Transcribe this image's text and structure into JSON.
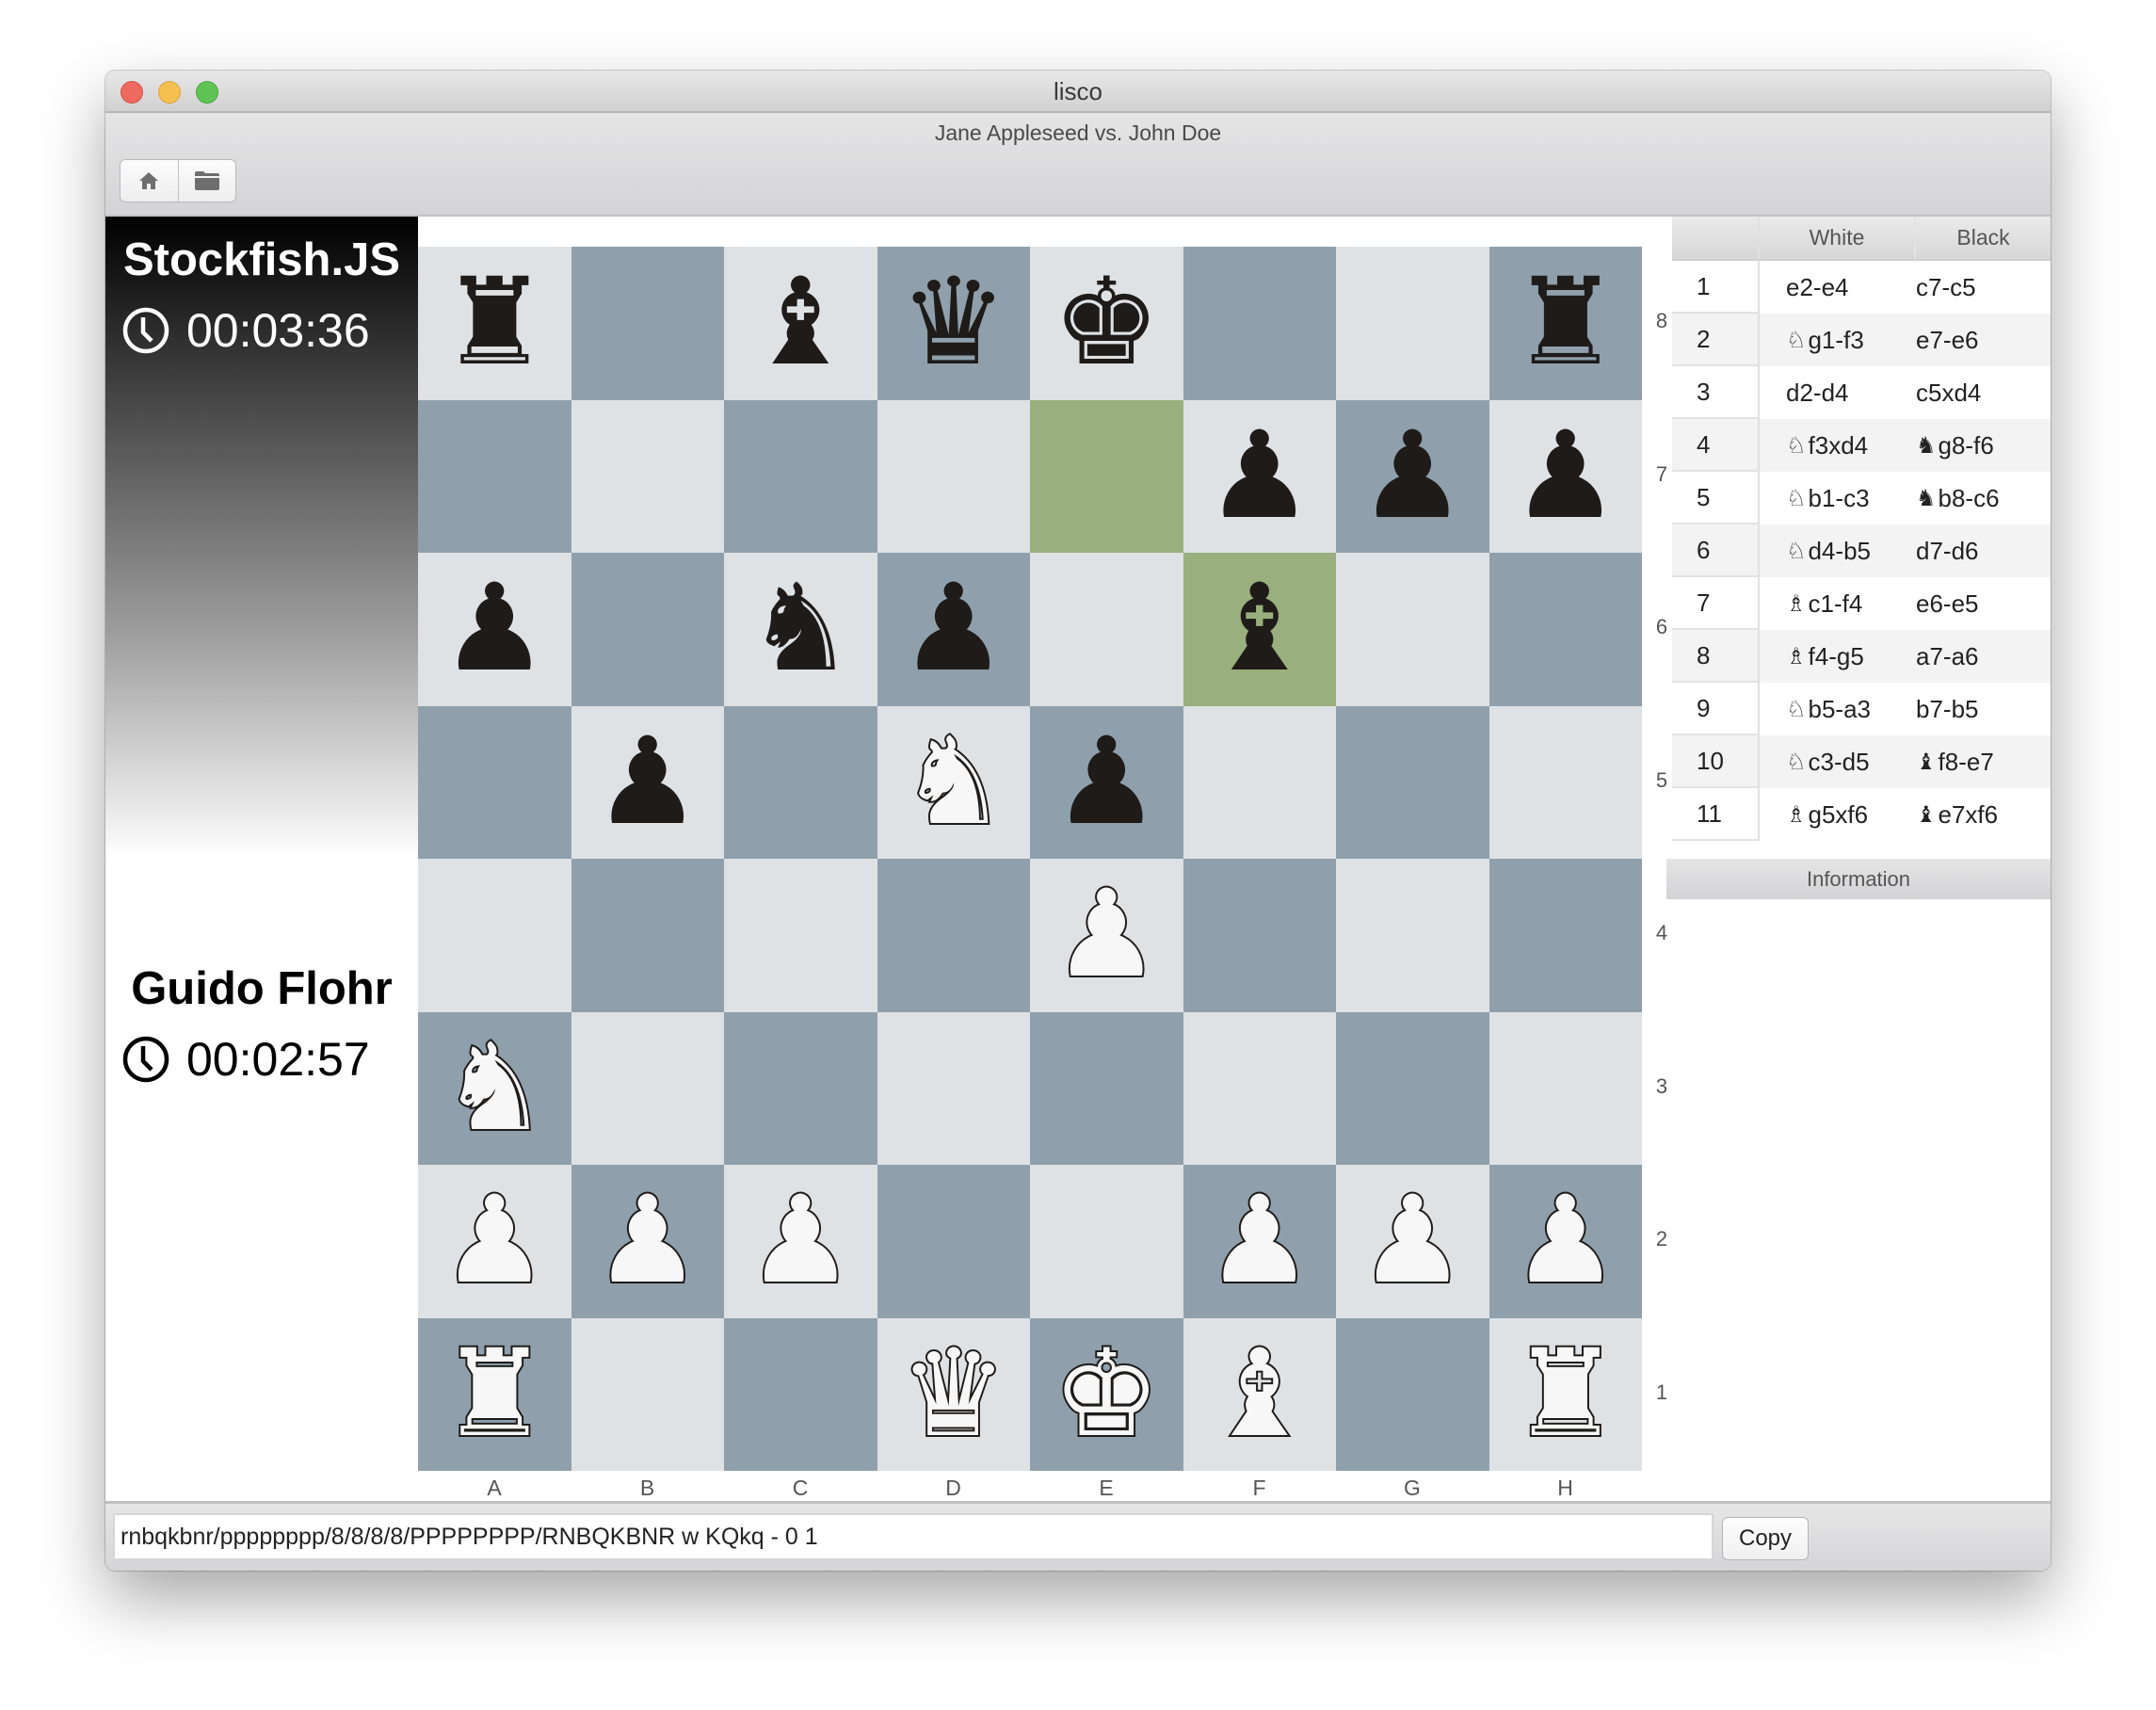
{
  "window": {
    "app_title": "lisco",
    "subtitle": "Jane Appleseed vs. John Doe"
  },
  "toolbar": {
    "buttons": [
      {
        "icon": "home-icon",
        "label": "Home"
      },
      {
        "icon": "folder-open-icon",
        "label": "Open"
      }
    ]
  },
  "players": {
    "top": {
      "name": "Stockfish.JS",
      "clock": "00:03:36",
      "color": "black"
    },
    "bottom": {
      "name": "Guido Flohr",
      "clock": "00:02:57",
      "color": "white"
    }
  },
  "board": {
    "colors": {
      "light": "#dfe2e5",
      "dark": "#8fa0ac",
      "highlight": "#99af7d"
    },
    "ranks": [
      [
        "r",
        "",
        "b",
        "q",
        "k",
        "",
        "",
        "r"
      ],
      [
        "",
        "",
        "",
        "",
        "",
        "p",
        "p",
        "p"
      ],
      [
        "p",
        "",
        "n",
        "p",
        "",
        "b",
        "",
        ""
      ],
      [
        "",
        "p",
        "",
        "N",
        "p",
        "",
        "",
        ""
      ],
      [
        "",
        "",
        "",
        "",
        "P",
        "",
        "",
        ""
      ],
      [
        "N",
        "",
        "",
        "",
        "",
        "",
        "",
        ""
      ],
      [
        "P",
        "P",
        "P",
        "",
        "",
        "P",
        "P",
        "P"
      ],
      [
        "R",
        "",
        "",
        "Q",
        "K",
        "B",
        "",
        "R"
      ]
    ],
    "highlighted_squares": [
      "e7",
      "f6"
    ],
    "rank_labels": [
      "8",
      "7",
      "6",
      "5",
      "4",
      "3",
      "2",
      "1"
    ],
    "file_labels": [
      "A",
      "B",
      "C",
      "D",
      "E",
      "F",
      "G",
      "H"
    ]
  },
  "moves": {
    "headers": {
      "number": "",
      "white": "White",
      "black": "Black"
    },
    "rows": [
      {
        "n": "1",
        "white": {
          "piece": "",
          "text": "e2-e4"
        },
        "black": {
          "piece": "",
          "text": "c7-c5"
        }
      },
      {
        "n": "2",
        "white": {
          "piece": "N",
          "text": "g1-f3"
        },
        "black": {
          "piece": "",
          "text": "e7-e6"
        }
      },
      {
        "n": "3",
        "white": {
          "piece": "",
          "text": "d2-d4"
        },
        "black": {
          "piece": "",
          "text": "c5xd4"
        }
      },
      {
        "n": "4",
        "white": {
          "piece": "N",
          "text": "f3xd4"
        },
        "black": {
          "piece": "n",
          "text": "g8-f6"
        }
      },
      {
        "n": "5",
        "white": {
          "piece": "N",
          "text": "b1-c3"
        },
        "black": {
          "piece": "n",
          "text": "b8-c6"
        }
      },
      {
        "n": "6",
        "white": {
          "piece": "N",
          "text": "d4-b5"
        },
        "black": {
          "piece": "",
          "text": "d7-d6"
        }
      },
      {
        "n": "7",
        "white": {
          "piece": "B",
          "text": "c1-f4"
        },
        "black": {
          "piece": "",
          "text": "e6-e5"
        }
      },
      {
        "n": "8",
        "white": {
          "piece": "B",
          "text": "f4-g5"
        },
        "black": {
          "piece": "",
          "text": "a7-a6"
        }
      },
      {
        "n": "9",
        "white": {
          "piece": "N",
          "text": "b5-a3"
        },
        "black": {
          "piece": "",
          "text": "b7-b5"
        }
      },
      {
        "n": "10",
        "white": {
          "piece": "N",
          "text": "c3-d5"
        },
        "black": {
          "piece": "b",
          "text": "f8-e7"
        }
      },
      {
        "n": "11",
        "white": {
          "piece": "B",
          "text": "g5xf6"
        },
        "black": {
          "piece": "b",
          "text": "e7xf6"
        }
      }
    ]
  },
  "info_panel": {
    "title": "Information"
  },
  "bottom": {
    "fen_value": "rnbqkbnr/pppppppp/8/8/8/8/PPPPPPPP/RNBQKBNR w KQkq - 0 1",
    "copy_label": "Copy"
  }
}
